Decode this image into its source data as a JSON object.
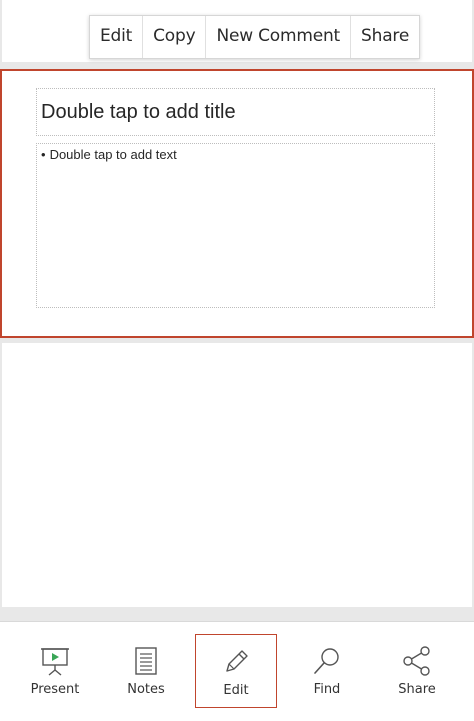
{
  "context_menu": {
    "items": [
      "Edit",
      "Copy",
      "New Comment",
      "Share"
    ]
  },
  "slide": {
    "title_placeholder": "Double tap to add title",
    "body_placeholder": "Double tap to add text",
    "bullet": "•"
  },
  "toolbar": {
    "items": [
      {
        "label": "Present",
        "icon": "present-icon"
      },
      {
        "label": "Notes",
        "icon": "notes-icon"
      },
      {
        "label": "Edit",
        "icon": "pencil-icon"
      },
      {
        "label": "Find",
        "icon": "search-icon"
      },
      {
        "label": "Share",
        "icon": "share-icon"
      }
    ],
    "active_index": 2
  },
  "colors": {
    "selection_border": "#c0452d",
    "present_play": "#3aa657"
  }
}
